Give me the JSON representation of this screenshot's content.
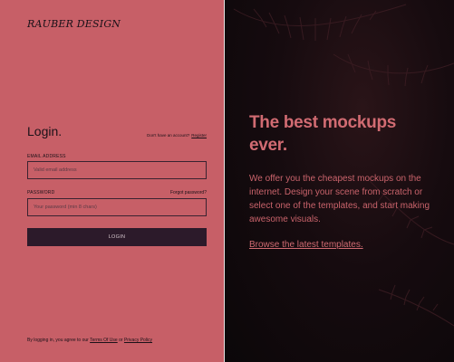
{
  "brand": {
    "logo_text": "RAUBER DESIGN"
  },
  "login": {
    "title": "Login.",
    "signup_prompt": "Don't have an account?",
    "signup_link": "Register",
    "email_label": "EMAIL ADDRESS",
    "email_placeholder": "Valid email address",
    "password_label": "PASSWORD",
    "forgot_link": "Forgot password?",
    "password_placeholder": "Your password (min 8 chars)",
    "submit_label": "LOGIN",
    "terms_prefix": "By logging in, you agree to our",
    "terms_link": "Terms Of Use",
    "terms_and": "or",
    "privacy_link": "Privacy Policy"
  },
  "hero": {
    "headline": "The best mockups ever.",
    "body": "We offer you the cheapest mockups on the internet. Design your scene from scratch or select one of the templates, and start making awesome visuals.",
    "cta_link": "Browse the latest templates."
  },
  "colors": {
    "left_panel_bg": "#c75f67",
    "accent_text": "#d16b72",
    "button_bg": "#2c1a2a",
    "right_panel_bg": "#0f0a0d"
  }
}
